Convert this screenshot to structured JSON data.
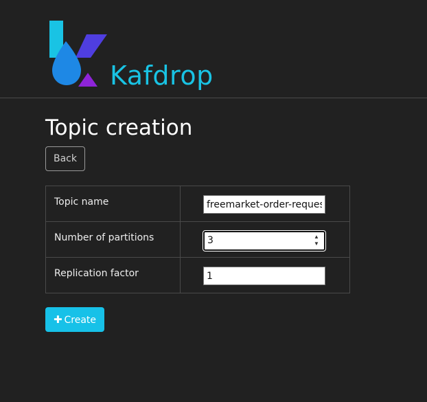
{
  "header": {
    "brand": "Kafdrop",
    "logo_icon": "kafdrop-logo-icon"
  },
  "page": {
    "title": "Topic creation",
    "back_label": "Back"
  },
  "form": {
    "rows": [
      {
        "label": "Topic name",
        "value": "freemarket-order-request"
      },
      {
        "label": "Number of partitions",
        "value": "3"
      },
      {
        "label": "Replication factor",
        "value": "1"
      }
    ],
    "create_label": "Create",
    "create_icon": "plus-icon"
  },
  "colors": {
    "background": "#212121",
    "brand": "#19c3e4",
    "create_button": "#17c1e8",
    "logo_drop": "#1e88e5",
    "logo_k": "#4f3ee0",
    "logo_purple": "#8e24d8"
  }
}
